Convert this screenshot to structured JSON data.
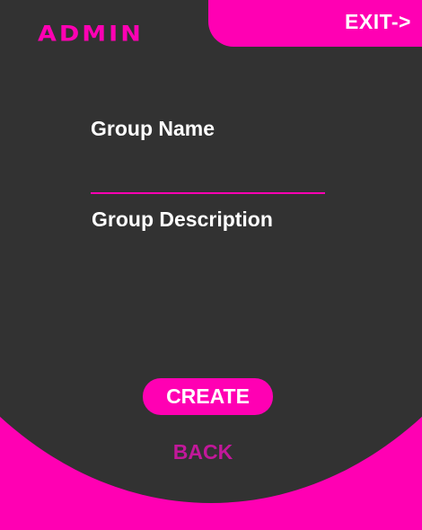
{
  "header": {
    "logo_text": "ADMIN",
    "exit_label": "EXIT->"
  },
  "form": {
    "group_name_label": "Group Name",
    "group_name_value": "",
    "group_description_label": "Group Description",
    "group_description_value": ""
  },
  "actions": {
    "create_label": "CREATE",
    "back_label": "BACK"
  },
  "colors": {
    "accent": "#ff00b3",
    "background": "#323232",
    "text": "#ffffff",
    "back_text": "#c2189a"
  }
}
